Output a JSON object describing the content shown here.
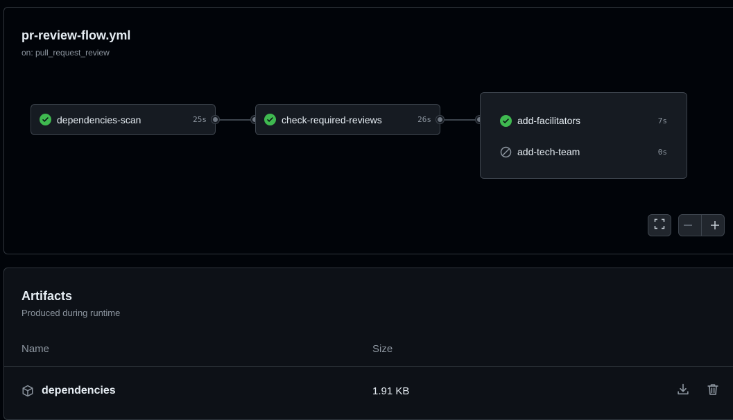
{
  "workflow": {
    "title": "pr-review-flow.yml",
    "trigger": "on: pull_request_review",
    "jobs": [
      {
        "name": "dependencies-scan",
        "duration": "25s",
        "status": "success"
      },
      {
        "name": "check-required-reviews",
        "duration": "26s",
        "status": "success"
      }
    ],
    "group_jobs": [
      {
        "name": "add-facilitators",
        "duration": "7s",
        "status": "success"
      },
      {
        "name": "add-tech-team",
        "duration": "0s",
        "status": "skipped"
      }
    ],
    "controls": {
      "fullscreen_icon": "fullscreen-icon",
      "zoom_out_icon": "minus-icon",
      "zoom_in_icon": "plus-icon"
    }
  },
  "artifacts": {
    "title": "Artifacts",
    "subtitle": "Produced during runtime",
    "columns": {
      "name": "Name",
      "size": "Size"
    },
    "rows": [
      {
        "name": "dependencies",
        "size": "1.91 KB",
        "icon": "package-icon"
      }
    ]
  },
  "colors": {
    "success": "#3fb950",
    "background": "#010409",
    "panel": "#0d1117",
    "card": "#161b22"
  }
}
